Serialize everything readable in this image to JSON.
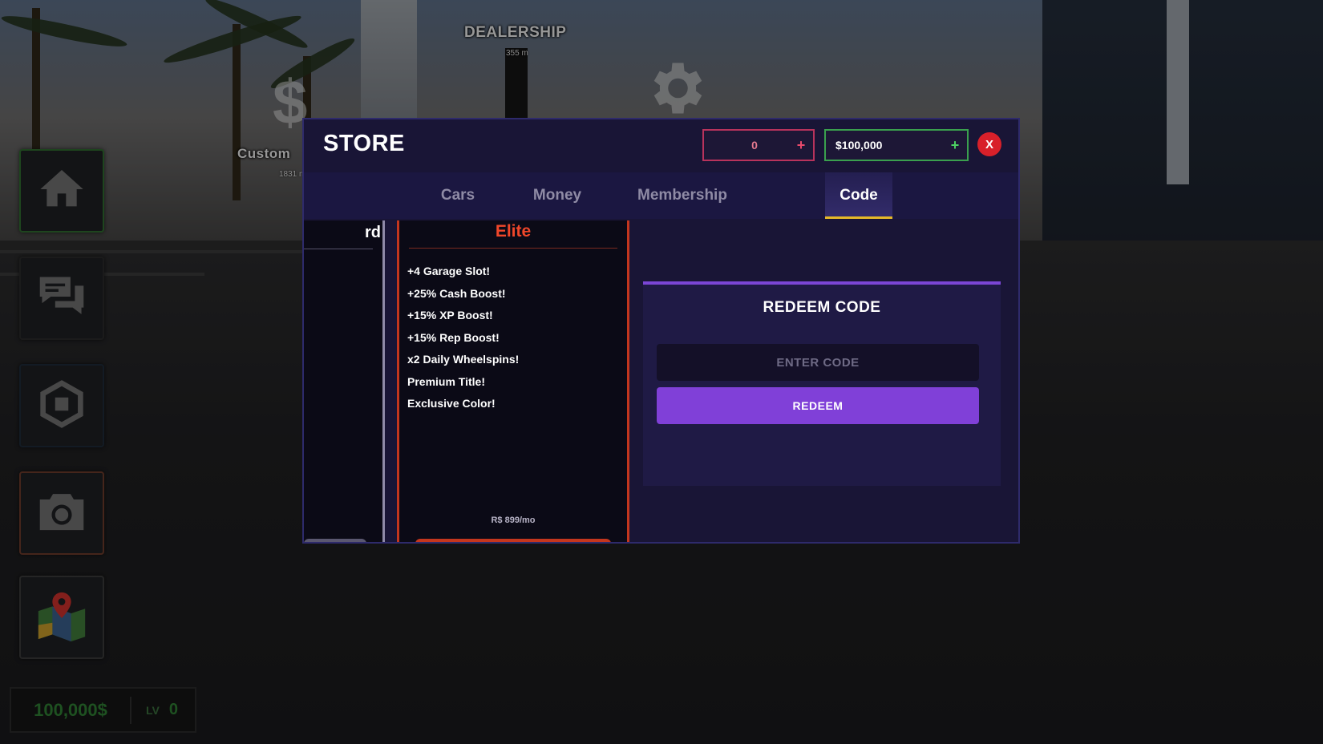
{
  "world": {
    "dealership_label": "DEALERSHIP",
    "dealership_distance": "355 m",
    "customize_label": "Custom",
    "customize_distance": "1831 m"
  },
  "hud": {
    "buttons": [
      {
        "icon": "home-icon"
      },
      {
        "icon": "chat-icon"
      },
      {
        "icon": "robux-icon"
      },
      {
        "icon": "camera-icon"
      },
      {
        "icon": "map-icon"
      }
    ],
    "money": "100,000$",
    "level_label": "LV",
    "level_value": "0"
  },
  "store": {
    "title": "STORE",
    "robux_balance": "0",
    "cash_balance": "$100,000",
    "plus_symbol": "+",
    "close_label": "X",
    "tabs": [
      {
        "label": "Cars"
      },
      {
        "label": "Money"
      },
      {
        "label": "Membership"
      },
      {
        "label": "Code",
        "active": true
      }
    ],
    "membership": {
      "partial_card_title": "rd",
      "elite": {
        "title": "Elite",
        "perks": [
          "+4 Garage Slot!",
          "+25% Cash Boost!",
          "+15% XP Boost!",
          "+15% Rep Boost!",
          "x2 Daily Wheelspins!",
          "Premium Title!",
          "Exclusive Color!"
        ],
        "price": "R$ 899/mo"
      }
    },
    "redeem": {
      "title": "REDEEM CODE",
      "input_value": "",
      "input_placeholder": "ENTER CODE",
      "button_label": "REDEEM"
    }
  },
  "colors": {
    "store_bg": "#191536",
    "accent_purple": "#8040d8",
    "tab_active_underline": "#e6b928",
    "elite_red": "#f0472a",
    "robux_border": "#b8335c",
    "cash_border": "#3aa04e",
    "close_red": "#d8202a",
    "hud_money_green": "#2f7d33"
  }
}
